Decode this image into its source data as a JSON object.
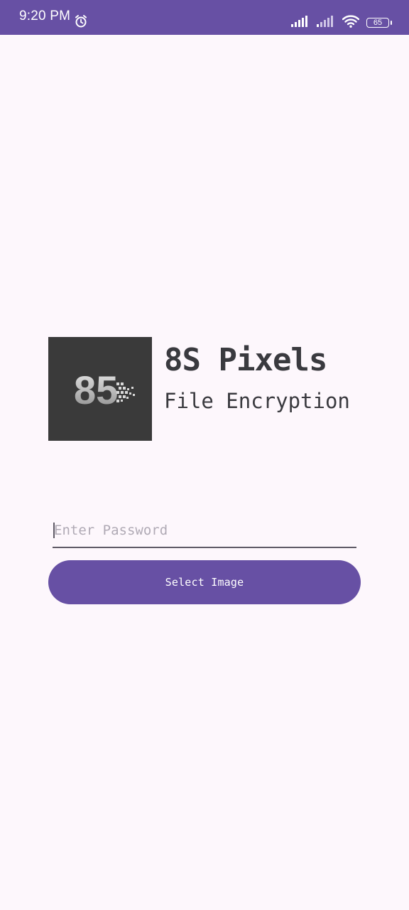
{
  "status_bar": {
    "time": "9:20 PM",
    "battery_level": "65",
    "icons": [
      "alarm-icon",
      "signal-icon",
      "signal-icon-secondary",
      "wifi-icon",
      "battery-icon"
    ]
  },
  "branding": {
    "logo_text": "85",
    "title": "8S Pixels",
    "subtitle": "File Encryption"
  },
  "form": {
    "password_placeholder": "Enter Password",
    "password_value": "",
    "select_image_label": "Select Image"
  },
  "colors": {
    "primary": "#6750a4",
    "background": "#fdf7fc",
    "text": "#3a3a3f",
    "logo_bg": "#3a3a3a"
  }
}
